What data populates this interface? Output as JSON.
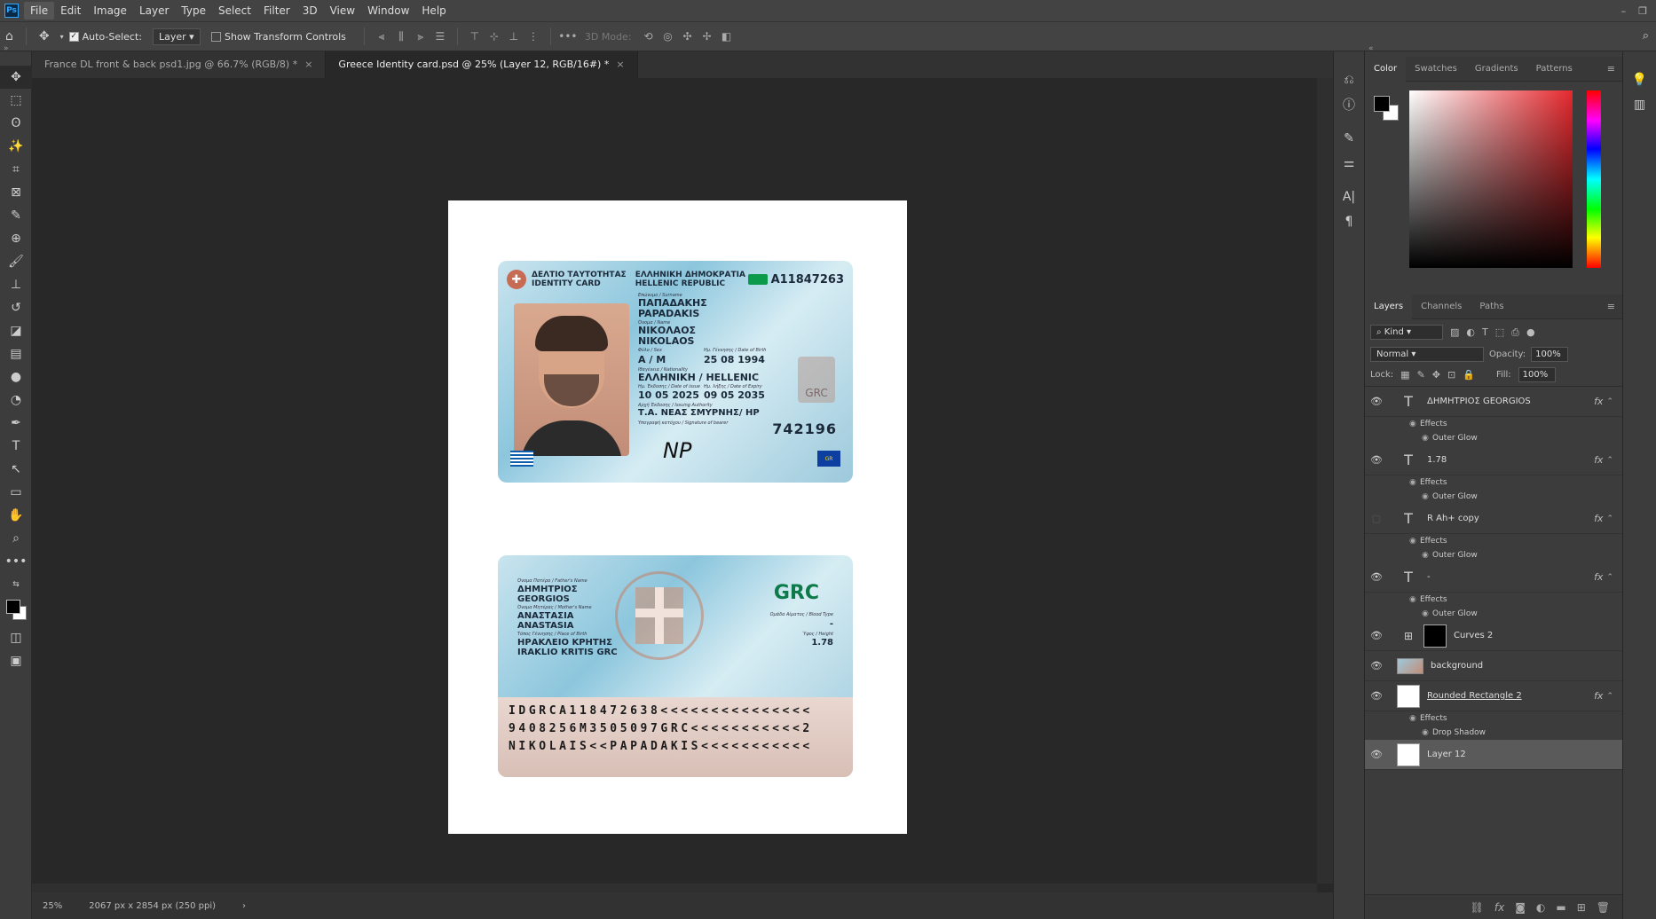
{
  "app": {
    "logo": "Ps"
  },
  "menu": [
    "File",
    "Edit",
    "Image",
    "Layer",
    "Type",
    "Select",
    "Filter",
    "3D",
    "View",
    "Window",
    "Help"
  ],
  "options": {
    "auto_select_label": "Auto-Select:",
    "auto_select_value": "Layer",
    "show_transform_label": "Show Transform Controls",
    "mode_3d_label": "3D Mode:"
  },
  "tabs": [
    {
      "label": "France DL front & back psd1.jpg @ 66.7% (RGB/8) *"
    },
    {
      "label": "Greece Identity card.psd @ 25% (Layer 12, RGB/16#) *"
    }
  ],
  "card_front": {
    "hdr_gr1": "ΔΕΛΤΙΟ ΤΑΥΤΟΤΗΤΑΣ",
    "hdr_en1": "IDENTITY CARD",
    "hdr_gr2": "ΕΛΛΗΝΙΚΗ ΔΗΜΟΚΡΑΤΙΑ",
    "hdr_en2": "HELLENIC REPUBLIC",
    "card_number": "A11847263",
    "lbl_surname": "Επώνυμο / Surname",
    "surname_gr": "ΠΑΠΑΔΑΚΗΣ",
    "surname_en": "PAPADAKIS",
    "lbl_name": "Όνομα / Name",
    "name_gr": "ΝΙΚΟΛΑΟΣ",
    "name_en": "NIKOLAOS",
    "lbl_sex": "Φύλο / Sex",
    "sex": "A / M",
    "lbl_dob": "Ημ. Γέννησης / Date of Birth",
    "dob": "25 08 1994",
    "lbl_nat": "Ιθαγένεια / Nationality",
    "nationality": "ΕΛΛΗΝΙΚΗ / HELLENIC",
    "lbl_issue": "Ημ. Έκδοσης / Date of issue",
    "issue": "10 05 2025",
    "lbl_expiry": "Ημ. λήξης / Date of Expiry",
    "expiry": "09 05 2035",
    "lbl_authority": "Αρχή Έκδοσης / Issuing Authority",
    "authority": "Τ.Α. ΝΕΑΣ ΣΜΥΡΝΗΣ/ ΗΡ",
    "lbl_sign": "Υπογραφή κατόχου / Signature of bearer",
    "ghost_text": "GRC",
    "doc_number": "742196",
    "signature": "NP",
    "eu_badge": "GR"
  },
  "card_back": {
    "lbl_father": "Όνομα Πατέρα / Father's Name",
    "father_gr": "ΔΗΜΗΤΡΙΟΣ",
    "father_en": "GEORGIOS",
    "lbl_mother": "Όνομα Μητέρας / Mother's Name",
    "mother_gr": "ΑΝΑΣΤΑΣΙΑ",
    "mother_en": "ANASTASIA",
    "lbl_birthplace": "Τόπος Γέννησης / Place of Birth",
    "birthplace_gr": "ΗΡΑΚΛΕΙΟ ΚΡΗΤΗΣ",
    "birthplace_en": "IRAKLIO KRITIS GRC",
    "grc": "GRC",
    "lbl_blood": "Ομάδα Αίματος / Blood Type",
    "blood": "-",
    "lbl_height": "Ύψος / Height",
    "height": "1.78",
    "mrz": [
      "IDGRCA118472638<<<<<<<<<<<<<<<",
      "9408256M3505097GRC<<<<<<<<<<<2",
      "NIKOLAIS<<PAPADAKIS<<<<<<<<<<<"
    ]
  },
  "status": {
    "zoom": "25%",
    "doc_info": "2067 px x 2854 px (250 ppi)"
  },
  "color_panel": {
    "tabs": [
      "Color",
      "Swatches",
      "Gradients",
      "Patterns"
    ]
  },
  "layers_panel": {
    "tabs": [
      "Layers",
      "Channels",
      "Paths"
    ],
    "kind": "Kind",
    "blend": "Normal",
    "opacity_label": "Opacity:",
    "opacity": "100%",
    "lock_label": "Lock:",
    "fill_label": "Fill:",
    "fill": "100%",
    "effects_label": "Effects",
    "layers": [
      {
        "name": "ΔΗΜΗΤΡΙΟΣ GEORGIOS",
        "effect": "Outer Glow"
      },
      {
        "name": "1.78",
        "effect": "Outer Glow"
      },
      {
        "name": "R Ah+ copy",
        "effect": "Outer Glow"
      },
      {
        "name": "-",
        "effect": "Outer Glow"
      },
      {
        "name": "Curves 2"
      },
      {
        "name": "background"
      },
      {
        "name": "Rounded Rectangle 2",
        "effect": "Drop Shadow"
      },
      {
        "name": "Layer 12"
      }
    ]
  }
}
